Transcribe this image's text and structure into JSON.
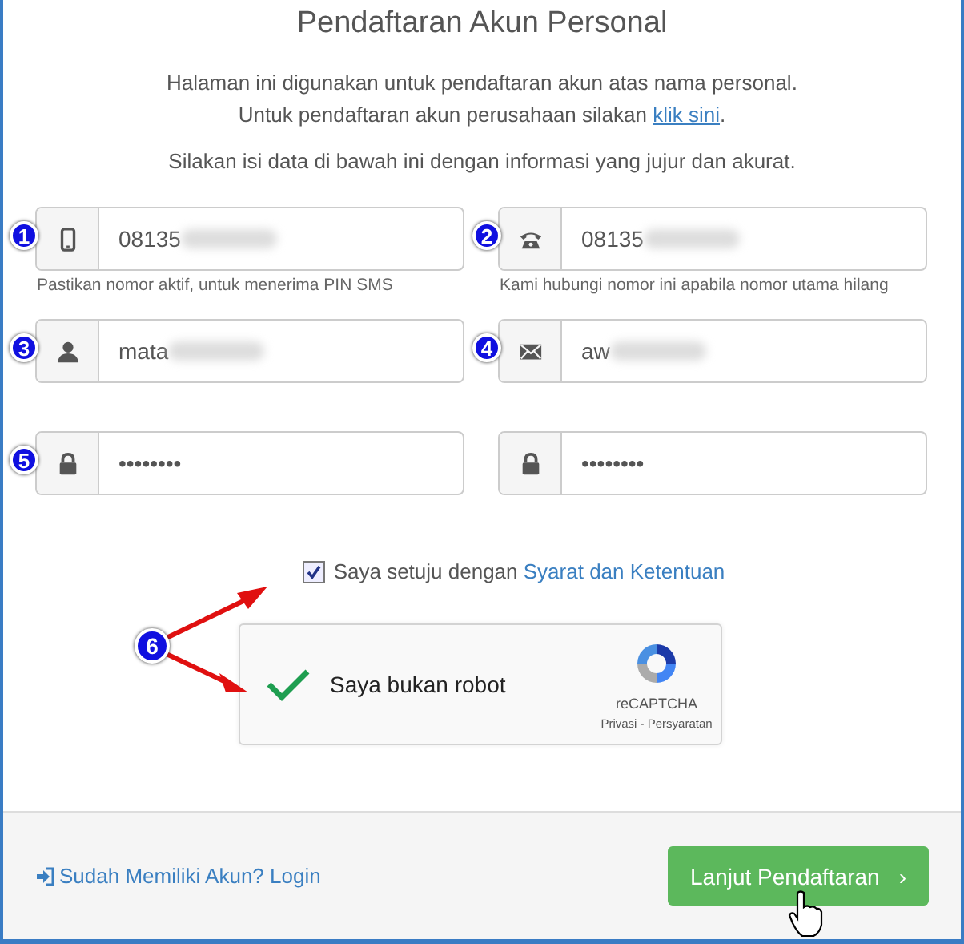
{
  "title": "Pendaftaran Akun Personal",
  "intro": {
    "line1": "Halaman ini digunakan untuk pendaftaran akun atas nama personal.",
    "line2": "Untuk pendaftaran akun perusahaan silakan",
    "link": "klik sini",
    "line2_end": "."
  },
  "instruction": "Silakan isi data di bawah ini dengan informasi yang jujur dan akurat.",
  "fields": [
    {
      "kind": "mobile",
      "value": "08135",
      "redacted": true,
      "marker": "1",
      "help": "Pastikan nomor aktif, untuk menerima PIN SMS"
    },
    {
      "kind": "phone",
      "value": "08135",
      "redacted": true,
      "marker": "2",
      "help": "Kami hubungi nomor ini apabila nomor utama hilang"
    },
    {
      "kind": "user",
      "value": "mata",
      "redacted": true,
      "marker": "3"
    },
    {
      "kind": "envelope",
      "value": "aw",
      "redacted": true,
      "marker": "4"
    },
    {
      "kind": "lock",
      "value": "••••••••",
      "redacted": false,
      "marker": "5"
    },
    {
      "kind": "lock",
      "value": "••••••••",
      "redacted": false
    }
  ],
  "agreement": {
    "checked": true,
    "text": "Saya setuju dengan",
    "link": "Syarat dan Ketentuan"
  },
  "captcha": {
    "marker": "6",
    "checked": true,
    "label": "Saya bukan robot",
    "brand": "reCAPTCHA",
    "links": "Privasi - Persyaratan"
  },
  "footer": {
    "login_link": "Sudah Memiliki Akun? Login",
    "button": "Lanjut Pendaftaran",
    "button_chevron": "›"
  }
}
